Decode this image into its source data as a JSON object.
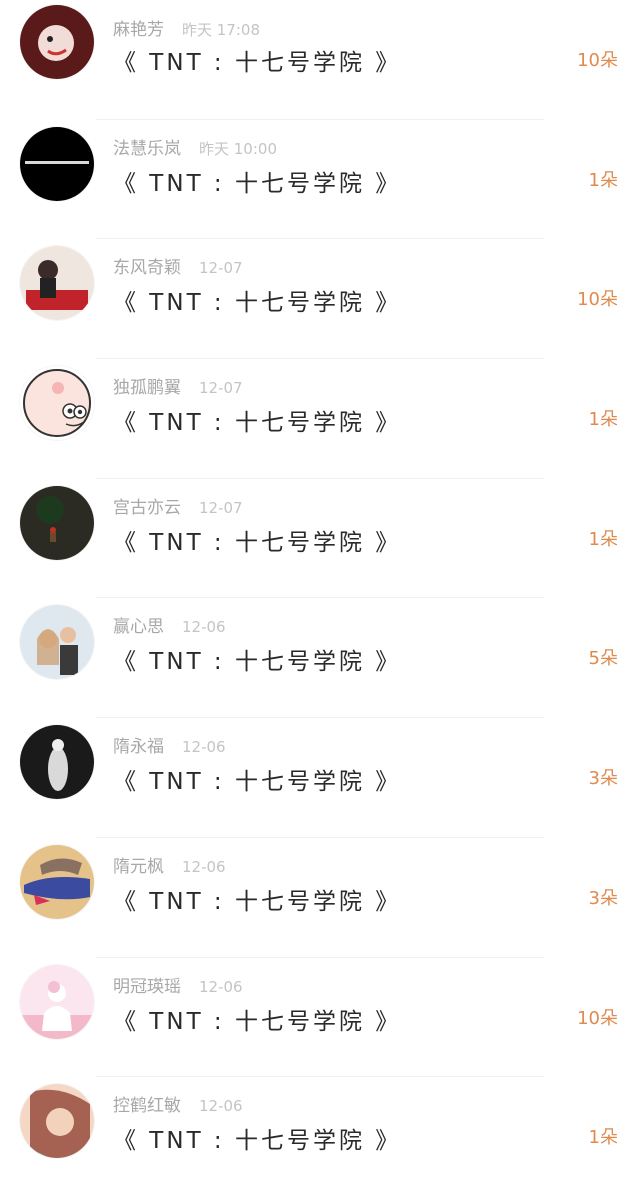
{
  "comments": [
    {
      "user": "麻艳芳",
      "time": "昨天 17:08",
      "title": "《 TNT : 十七号学院 》",
      "gift": "10朵",
      "avatar": {
        "icon": "avatar-icon",
        "bg": "#5a1a1a",
        "accent": "#f2dcd7"
      }
    },
    {
      "user": "法慧乐岚",
      "time": "昨天 10:00",
      "title": "《 TNT : 十七号学院 》",
      "gift": "1朵",
      "avatar": {
        "icon": "avatar-icon",
        "bg": "#000000",
        "accent": "#ffffff"
      }
    },
    {
      "user": "东风奇颖",
      "time": "12-07",
      "title": "《 TNT : 十七号学院 》",
      "gift": "10朵",
      "avatar": {
        "icon": "avatar-icon",
        "bg": "#f0e6e0",
        "accent": "#c0242a"
      }
    },
    {
      "user": "独孤鹏翼",
      "time": "12-07",
      "title": "《 TNT : 十七号学院 》",
      "gift": "1朵",
      "avatar": {
        "icon": "cartoon-pig-icon",
        "bg": "#fbe4dd",
        "accent": "#f6b4b4"
      }
    },
    {
      "user": "宫古亦云",
      "time": "12-07",
      "title": "《 TNT : 十七号学院 》",
      "gift": "1朵",
      "avatar": {
        "icon": "avatar-icon",
        "bg": "#2b2a23",
        "accent": "#6a4a2a"
      }
    },
    {
      "user": "赢心思",
      "time": "12-06",
      "title": "《 TNT : 十七号学院 》",
      "gift": "5朵",
      "avatar": {
        "icon": "avatar-icon",
        "bg": "#dfe7ef",
        "accent": "#3a3a3a"
      }
    },
    {
      "user": "隋永福",
      "time": "12-06",
      "title": "《 TNT : 十七号学院 》",
      "gift": "3朵",
      "avatar": {
        "icon": "avatar-icon",
        "bg": "#1a1a1a",
        "accent": "#d9d9d9"
      }
    },
    {
      "user": "隋元枫",
      "time": "12-06",
      "title": "《 TNT : 十七号学院 》",
      "gift": "3朵",
      "avatar": {
        "icon": "avatar-icon",
        "bg": "#e5c28a",
        "accent": "#3b4ba0"
      }
    },
    {
      "user": "明冠瑛瑶",
      "time": "12-06",
      "title": "《 TNT : 十七号学院 》",
      "gift": "10朵",
      "avatar": {
        "icon": "avatar-icon",
        "bg": "#fbe6ef",
        "accent": "#f3b9c8"
      }
    },
    {
      "user": "控鹤红敏",
      "time": "12-06",
      "title": "《 TNT : 十七号学院 》",
      "gift": "1朵",
      "avatar": {
        "icon": "avatar-icon",
        "bg": "#f5d7c5",
        "accent": "#8a3a2a"
      }
    }
  ],
  "colors": {
    "gift": "#e08a4d",
    "name": "#a8a8a8",
    "time": "#c4c4c4",
    "title": "#2a2a2a"
  }
}
